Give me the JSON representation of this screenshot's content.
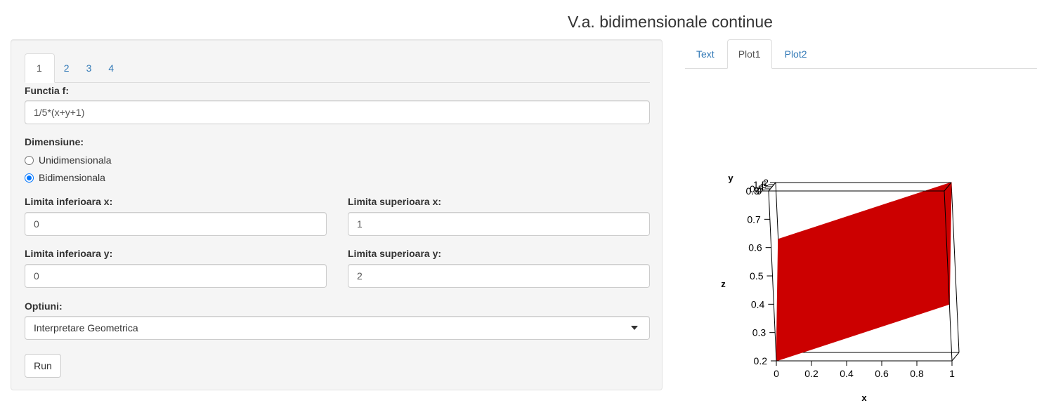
{
  "page": {
    "title": "V.a. bidimensionale continue"
  },
  "sidebar": {
    "tabs": [
      "1",
      "2",
      "3",
      "4"
    ],
    "active_tab": "1",
    "function_label": "Functia f:",
    "function_value": "1/5*(x+y+1)",
    "dimension_label": "Dimensiune:",
    "dimension_options": [
      "Unidimensionala",
      "Bidimensionala"
    ],
    "dimension_selected": "Bidimensionala",
    "x_lower_label": "Limita inferioara x:",
    "x_lower_value": "0",
    "x_upper_label": "Limita superioara x:",
    "x_upper_value": "1",
    "y_lower_label": "Limita inferioara y:",
    "y_lower_value": "0",
    "y_upper_label": "Limita superioara y:",
    "y_upper_value": "2",
    "options_label": "Optiuni:",
    "options_selected": "Interpretare Geometrica",
    "run_label": "Run"
  },
  "main": {
    "tabs": [
      "Text",
      "Plot1",
      "Plot2"
    ],
    "active_tab": "Plot1"
  },
  "chart_data": {
    "type": "surface3d",
    "function": "1/5*(x+y+1)",
    "surface_color": "#cc0000",
    "x": {
      "label": "x",
      "range": [
        0,
        1
      ],
      "ticks": [
        "0",
        "0.2",
        "0.4",
        "0.6",
        "0.8",
        "1"
      ]
    },
    "y": {
      "label": "y",
      "range": [
        0,
        2
      ],
      "ticks": [
        "0",
        "0.5",
        "1",
        "1.5",
        "2"
      ]
    },
    "z": {
      "label": "z",
      "range": [
        0.2,
        0.8
      ],
      "ticks": [
        "0.2",
        "0.3",
        "0.4",
        "0.5",
        "0.6",
        "0.7",
        "0.8"
      ]
    },
    "corners": [
      {
        "x": 0,
        "y": 0,
        "z": 0.2
      },
      {
        "x": 1,
        "y": 0,
        "z": 0.4
      },
      {
        "x": 1,
        "y": 2,
        "z": 0.8
      },
      {
        "x": 0,
        "y": 2,
        "z": 0.6
      }
    ]
  }
}
